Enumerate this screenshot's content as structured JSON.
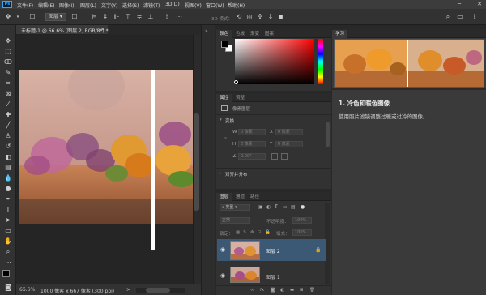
{
  "app": {
    "logo_text": "Ps"
  },
  "menu": {
    "items": [
      "文件(F)",
      "编辑(E)",
      "图像(I)",
      "图层(L)",
      "文字(Y)",
      "选择(S)",
      "滤镜(T)",
      "3D(D)",
      "视图(V)",
      "窗口(W)",
      "帮助(H)"
    ]
  },
  "options_bar": {
    "layer_select": "图层",
    "mode3d_label": "3D 模式："
  },
  "document": {
    "tab_title": "未标题-1 @ 66.6% (图层 2, RGB/8*) *",
    "close_glyph": "×"
  },
  "status": {
    "zoom": "66.6%",
    "info": "1000 像素 x 667 像素 (300 ppi)",
    "arrow": ">"
  },
  "color_panel": {
    "tabs": [
      "颜色",
      "色板",
      "渐变",
      "图案"
    ],
    "fg_color": "#000000",
    "bg_color": "#ffffff"
  },
  "properties_panel": {
    "tabs": [
      "属性",
      "调整"
    ],
    "layer_kind": "像素图层",
    "transform_section": "变换",
    "w_label": "W",
    "w_value": "0 像素",
    "x_label": "X",
    "x_value": "0 像素",
    "h_label": "H",
    "h_value": "0 像素",
    "y_label": "Y",
    "y_value": "0 像素",
    "angle_value": "0.00°",
    "align_section": "对齐并分布"
  },
  "learn_panel": {
    "tab": "学习",
    "tutorial_title": "1. 冷色和暖色图像",
    "tutorial_desc": "使用照片滤镜调整过暖或过冷的图像。"
  },
  "layers_panel": {
    "tabs": [
      "图层",
      "通道",
      "路径"
    ],
    "filter_kind": "类型",
    "blend_mode": "正常",
    "opacity_label": "不透明度：",
    "opacity_value": "100%",
    "lock_label": "锁定：",
    "fill_label": "填充：",
    "fill_value": "100%",
    "layers": [
      {
        "name": "图层 2",
        "selected": true,
        "visible": true,
        "locked": true
      },
      {
        "name": "图层 1",
        "selected": false,
        "visible": true,
        "locked": false
      }
    ]
  },
  "colors": {
    "accent": "#31a8ff",
    "selection": "#3b5874"
  }
}
